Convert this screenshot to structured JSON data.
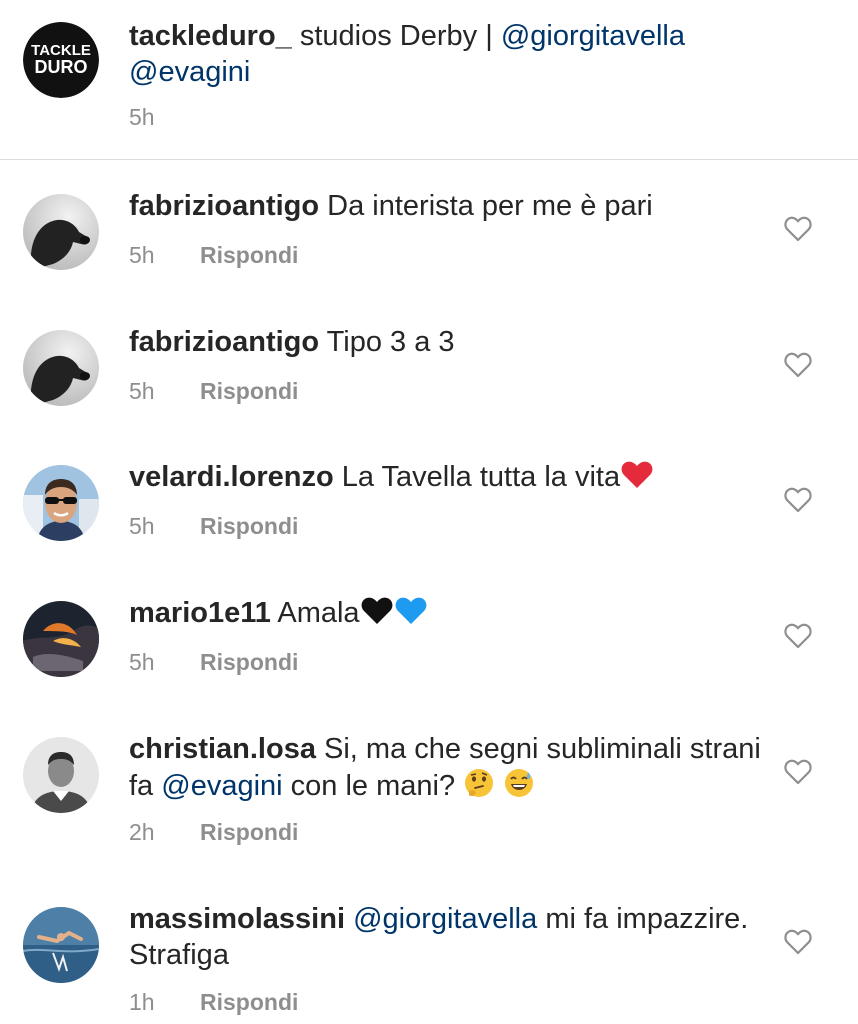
{
  "caption": {
    "avatar_logo_line1": "TACKLE",
    "avatar_logo_line2": "DURO",
    "username": "tackleduro_",
    "text": " studios Derby | ",
    "mention1": "@giorgitavella",
    "mention2": "@evagini",
    "time": "5h"
  },
  "reply_label": "Rispondi",
  "comments": [
    {
      "username": "fabrizioantigo",
      "text": " Da interista per me è  pari",
      "time": "5h"
    },
    {
      "username": "fabrizioantigo",
      "text": " Tipo 3 a 3",
      "time": "5h"
    },
    {
      "username": "velardi.lorenzo",
      "text": " La Tavella tutta la vita",
      "emoji": [
        "red-heart"
      ],
      "time": "5h"
    },
    {
      "username": "mario1e11",
      "text": " Amala",
      "emoji": [
        "black-heart",
        "blue-heart"
      ],
      "time": "5h"
    },
    {
      "username": "christian.losa",
      "text": " Si, ma che segni subliminali strani fa ",
      "mention": "@evagini",
      "text_after": " con le mani? ",
      "emoji": [
        "thinking-face",
        "grinning-sweat-face"
      ],
      "time": "2h"
    },
    {
      "username": "massimolassini",
      "text": " ",
      "mention": "@giorgitavella",
      "text_after": " mi fa impazzire. Strafiga",
      "time": "1h"
    }
  ],
  "colors": {
    "text": "#262626",
    "muted": "#8e8e8e",
    "mention": "#003569",
    "divider": "#dbdbdb"
  }
}
